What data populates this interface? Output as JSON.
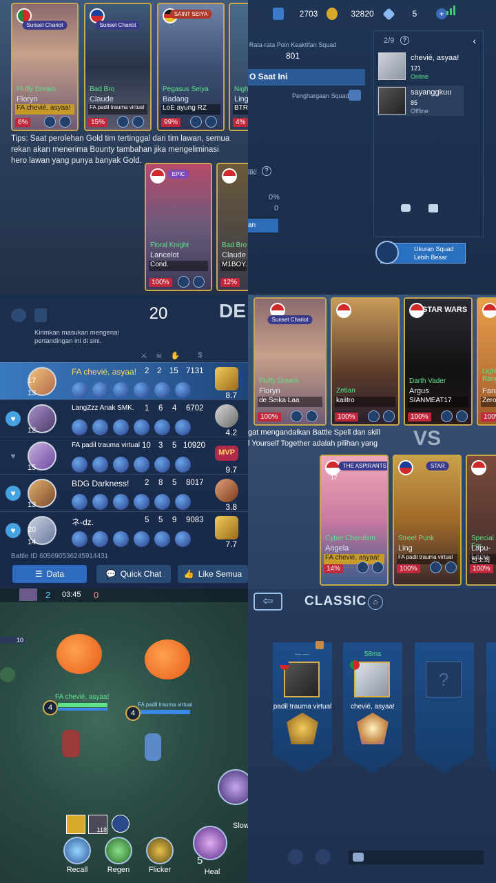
{
  "q1": {
    "cards": [
      {
        "badge": "Sunset Chariot",
        "skin": "Fluffy Dream",
        "hero": "Floryn",
        "player": "FA chevié, asyaa!",
        "pct": "6%"
      },
      {
        "badge": "Sunset Chariot",
        "skin": "Bad Bro",
        "hero": "Claude",
        "player": "FA padil trauma virtual",
        "pct": "15%"
      },
      {
        "badge": "SAINT SEIYA",
        "skin": "Pegasus Seiya",
        "hero": "Badang",
        "player": "LoE ayung RZ",
        "pct": "99%"
      },
      {
        "badge": "",
        "skin": "Night",
        "hero": "Ling",
        "player": "BTR D",
        "pct": "4%"
      }
    ],
    "tips": "Tips: Saat perolehan Gold tim tertinggal dari tim lawan, semua rekan akan menerima Bounty tambahan jika mengeliminasi hero lawan yang punya banyak Gold.",
    "lower_cards": [
      {
        "badge": "EPIC",
        "skin": "Floral Knight",
        "hero": "Lancelot",
        "player": "Cond.",
        "pct": "100%"
      },
      {
        "badge": "",
        "skin": "Bad Bro",
        "hero": "Claude",
        "player": "M1BOY.",
        "pct": "12%"
      }
    ]
  },
  "q2": {
    "tickets": "2703",
    "gold": "32820",
    "diamonds": "5",
    "plus": "+",
    "avg_label": "Rata-rata Poin Keaktifan Squad",
    "avg_value": "801",
    "now_label": "O Saat Ini",
    "award_label": "Penghargaan Squad",
    "liki_label": "liki",
    "pct_value": "0%",
    "zero_value": "0",
    "arrow_btn": "an",
    "friends_count": "2/9",
    "friends": [
      {
        "name": "chevié, asyaa!",
        "level": "121",
        "status": "Online"
      },
      {
        "name": "sayanggkuu",
        "level": "85",
        "status": "Offline"
      }
    ],
    "squad_btn_line1": "Ukuran Squad",
    "squad_btn_line2": "Lebih Besar"
  },
  "q3": {
    "timer": "20",
    "def_label": "DE",
    "feedback": "Kirimkan masukan mengenai pertandingan ini di sini.",
    "rows": [
      {
        "name": "FA chevié, asyaa!",
        "rank_top": "17",
        "rank": "13",
        "k": "2",
        "d": "2",
        "a": "15",
        "gold": "7131",
        "score": "8.7"
      },
      {
        "name": "LangZzz Anak SMK.",
        "rank_top": "",
        "rank": "12",
        "k": "1",
        "d": "6",
        "a": "4",
        "gold": "6702",
        "score": "4.2"
      },
      {
        "name": "FA padil trauma virtual",
        "rank_top": "",
        "rank": "15",
        "k": "10",
        "d": "3",
        "a": "5",
        "gold": "10920",
        "score": "9.7"
      },
      {
        "name": "BDG Darkness!",
        "rank_top": "",
        "rank": "13",
        "k": "2",
        "d": "8",
        "a": "5",
        "gold": "8017",
        "score": "3.8"
      },
      {
        "name": "ネ-dz.",
        "rank_top": "20",
        "rank": "14",
        "k": "5",
        "d": "5",
        "a": "9",
        "gold": "9083",
        "score": "7.7"
      }
    ],
    "mvp": "MVP",
    "battle_id": "Battle ID   605690536245914431",
    "btn_data": "Data",
    "btn_chat": "Quick Chat",
    "btn_like": "Like Semua"
  },
  "q4": {
    "cards": [
      {
        "badge": "Sunset Chariot",
        "skin": "Fluffy Dream",
        "hero": "Floryn",
        "player": "de Seika Laa",
        "pct": "100%"
      },
      {
        "badge": "",
        "skin": "Zetian",
        "hero": "",
        "player": "kaiitro",
        "pct": "100%"
      },
      {
        "badge": "STAR WARS",
        "skin": "Darth Vader",
        "hero": "Argus",
        "player": "SIANMEAT17",
        "pct": "100%"
      },
      {
        "badge": "",
        "skin": "Lightbo Range",
        "hero": "Fanny",
        "player": "Zero.",
        "pct": "100%"
      }
    ],
    "tip": "gat mengandalkan Battle Spell dan skill\nl Yourself Together adalah pilihan yang",
    "vs": "VS",
    "lower_cards": [
      {
        "badge": "THE ASPIRANTS",
        "skin": "Cyber Cherubim",
        "hero": "Angela",
        "player": "FA chevié, asyaa!",
        "pct": "14%",
        "rank": "17"
      },
      {
        "badge": "STAR",
        "skin": "Street Punk",
        "hero": "Ling",
        "player": "FA padil trauma virtual",
        "pct": "100%"
      },
      {
        "badge": "",
        "skin": "Special For",
        "hero": "Lapu-Lapu",
        "player": "한소희",
        "pct": "100%"
      }
    ]
  },
  "q5": {
    "kills": "2",
    "time": "03:45",
    "deaths": "0",
    "ten": "10",
    "p1_level": "4",
    "p1_name": "FA chevié, asyaa!",
    "p2_level": "4",
    "p2_name": "FA padil trauma virtual",
    "item_count": "118",
    "recall": "Recall",
    "regen": "Regen",
    "flicker": "Flicker",
    "heal": "Heal",
    "heal_count": "5",
    "slow": "Slow"
  },
  "q6": {
    "title": "CLASSIC",
    "player1_name": "padil trauma virtual",
    "player1_top": "— —",
    "player2_name": "chevié, asyaa!",
    "player2_ping": "58ms",
    "unknown": "?"
  }
}
